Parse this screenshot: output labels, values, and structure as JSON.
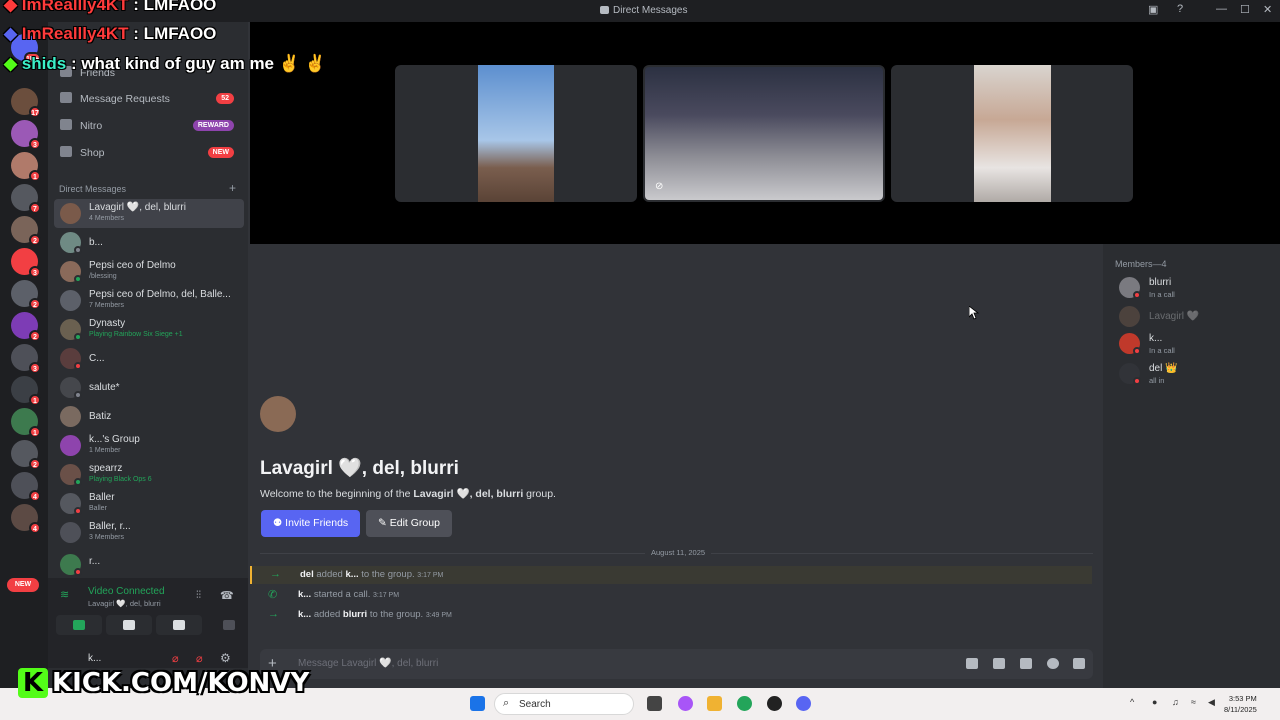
{
  "window": {
    "title": "Direct Messages"
  },
  "overlay_chat": [
    {
      "user": "ImReallly4KT",
      "message": ": LMFAOO"
    },
    {
      "user": "ImReallly4KT",
      "message": ": LMFAOO"
    },
    {
      "user": "shids",
      "message": ": what kind of guy am me ✌️ ✌️"
    }
  ],
  "rail": {
    "new_label": "NEW",
    "badges": [
      "1K+",
      "17",
      "3",
      "1",
      "7",
      "2",
      "3",
      "2",
      "2",
      "3",
      "1",
      "1",
      "2",
      "4",
      "4"
    ]
  },
  "nav": {
    "friends": "Friends",
    "message_requests": "Message Requests",
    "message_requests_count": "52",
    "nitro": "Nitro",
    "nitro_pill": "REWARD",
    "shop": "Shop",
    "shop_pill": "NEW"
  },
  "dm_header": "Direct Messages",
  "dms": [
    {
      "name": "Lavagirl 🤍, del, blurri",
      "sub": "4 Members"
    },
    {
      "name": "b...",
      "sub": ""
    },
    {
      "name": "Pepsi ceo of Delmo",
      "sub": "/blessing"
    },
    {
      "name": "Pepsi ceo of Delmo, del, Balle...",
      "sub": "7 Members"
    },
    {
      "name": "Dynasty",
      "sub": "Playing Rainbow Six Siege +1"
    },
    {
      "name": "C...",
      "sub": ""
    },
    {
      "name": "salute*",
      "sub": ""
    },
    {
      "name": "Batiz",
      "sub": ""
    },
    {
      "name": "k...'s Group",
      "sub": "1 Member"
    },
    {
      "name": "spearrz",
      "sub": "Playing Black Ops 6"
    },
    {
      "name": "Baller",
      "sub": "Baller"
    },
    {
      "name": "Baller, r...",
      "sub": "3 Members"
    },
    {
      "name": "r...",
      "sub": ""
    }
  ],
  "voice": {
    "status": "Video Connected",
    "channel": "Lavagirl 🤍, del, blurri"
  },
  "user_panel": {
    "name": "k..."
  },
  "group": {
    "title": "Lavagirl 🤍, del, blurri",
    "welcome_prefix": "Welcome to the beginning of the ",
    "welcome_name": "Lavagirl 🤍, del, blurri",
    "welcome_suffix": " group.",
    "invite_label": "Invite Friends",
    "edit_label": "Edit Group"
  },
  "date_separator": "August 11, 2025",
  "system_messages": [
    {
      "actor": "del",
      "action": " added ",
      "target": "k...",
      "tail": " to the group.",
      "time": "3:17 PM"
    },
    {
      "actor": "k...",
      "action": " started a call.",
      "target": "",
      "tail": "",
      "time": "3:17 PM"
    },
    {
      "actor": "k...",
      "action": " added ",
      "target": "blurri",
      "tail": " to the group.",
      "time": "3:49 PM"
    }
  ],
  "composer": {
    "placeholder": "Message Lavagirl 🤍, del, blurri"
  },
  "members_header": "Members—4",
  "members": [
    {
      "name": "blurri",
      "status": "In a call"
    },
    {
      "name": "Lavagirl 🤍",
      "status": ""
    },
    {
      "name": "k...",
      "status": "In a call"
    },
    {
      "name": "del 👑",
      "status": "all in"
    }
  ],
  "taskbar": {
    "search": "Search",
    "time": "3:53 PM",
    "date": "8/11/2025"
  },
  "watermark": "KICK.COM/KONVY",
  "colors": {
    "blurple": "#5865f2",
    "online": "#23a55a",
    "dnd": "#f23f43",
    "nitro": "#a855f7"
  }
}
